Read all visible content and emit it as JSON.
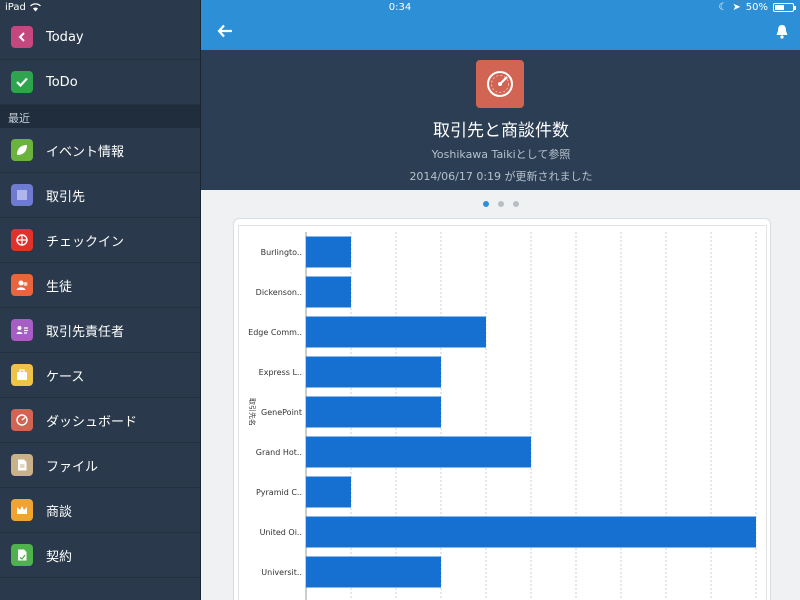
{
  "status": {
    "device": "iPad",
    "time": "0:34",
    "battery": "50%",
    "battery_level": 0.5
  },
  "sidebar": {
    "pinned": [
      {
        "label": "Today",
        "icon": "back-arrow-icon",
        "color": "#c4487d"
      },
      {
        "label": "ToDo",
        "icon": "check-icon",
        "color": "#2ea44f"
      }
    ],
    "section_label": "最近",
    "recent": [
      {
        "label": "イベント情報",
        "icon": "leaf-icon",
        "color": "#6ab43e"
      },
      {
        "label": "取引先",
        "icon": "account-icon",
        "color": "#6f7bd0"
      },
      {
        "label": "チェックイン",
        "icon": "globe-icon",
        "color": "#e0322b"
      },
      {
        "label": "生徒",
        "icon": "student-icon",
        "color": "#e8663d"
      },
      {
        "label": "取引先責任者",
        "icon": "contact-card-icon",
        "color": "#a45ec4"
      },
      {
        "label": "ケース",
        "icon": "briefcase-icon",
        "color": "#efc34a"
      },
      {
        "label": "ダッシュボード",
        "icon": "gauge-icon",
        "color": "#d26454"
      },
      {
        "label": "ファイル",
        "icon": "file-icon",
        "color": "#c9b189"
      },
      {
        "label": "商談",
        "icon": "crown-icon",
        "color": "#f0a234"
      },
      {
        "label": "契約",
        "icon": "contract-icon",
        "color": "#4fb24d"
      }
    ]
  },
  "header": {
    "icon": "gauge-icon",
    "title": "取引先と商談件数",
    "viewer": "Yoshikawa Taikiとして参照",
    "updated": "2014/06/17 0:19 が更新されました"
  },
  "pager": {
    "count": 3,
    "active": 0
  },
  "chart_data": {
    "type": "bar",
    "orientation": "horizontal",
    "categories": [
      "Burlingto..",
      "Dickenson..",
      "Edge Comm..",
      "Express L..",
      "GenePoint",
      "Grand Hot..",
      "Pyramid C..",
      "United Oi..",
      "Universit.."
    ],
    "values": [
      1,
      1,
      4,
      3,
      3,
      5,
      1,
      10,
      3
    ],
    "ylabel": "取引先名",
    "xlim": [
      0,
      10
    ],
    "xticks": [
      0,
      2,
      4,
      6,
      8,
      10
    ],
    "grid": true,
    "bar_color": "#1670d1"
  }
}
